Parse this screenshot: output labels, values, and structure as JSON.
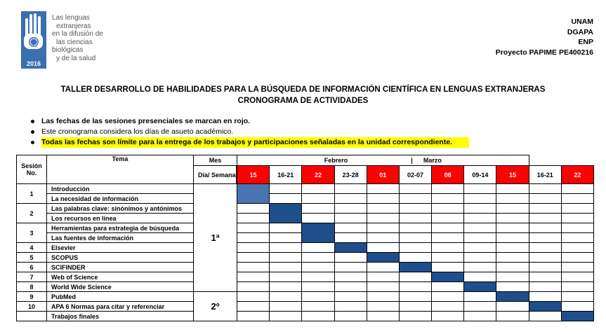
{
  "logo": {
    "year": "2016",
    "lines": [
      "Las lenguas",
      "extranjeras",
      "en la difusión de",
      "las ciencias",
      "biológicas",
      "y de la salud"
    ]
  },
  "institution": [
    "UNAM",
    "DGAPA",
    "ENP",
    "Proyecto PAPIME PE400216"
  ],
  "title": "TALLER DESARROLLO DE HABILIDADES PARA LA BÚSQUEDA DE INFORMACIÓN CIENTÍFICA EN LENGUAS EXTRANJERAS",
  "subtitle": "CRONOGRAMA DE ACTIVIDADES",
  "notes": [
    "Las fechas de las sesiones presenciales se marcan en rojo.",
    "Este cronograma considera los días de asueto académico.",
    "Todas las fechas son límite para la entrega de los trabajos y participaciones señaladas en la unidad correspondiente."
  ],
  "table": {
    "header": {
      "session": "Sesión No.",
      "topic": "Tema",
      "mes": "Mes",
      "dia": "Día/ Semana",
      "months": "Febrero                                    |      Marzo"
    },
    "weeks": [
      {
        "label": "15",
        "red": true
      },
      {
        "label": "16-21",
        "red": false
      },
      {
        "label": "22",
        "red": true
      },
      {
        "label": "23-28",
        "red": false
      },
      {
        "label": "01",
        "red": true
      },
      {
        "label": "02-07",
        "red": false
      },
      {
        "label": "08",
        "red": true
      },
      {
        "label": "09-14",
        "red": false
      },
      {
        "label": "15",
        "red": true
      },
      {
        "label": "16-21",
        "red": false
      },
      {
        "label": "22",
        "red": true
      }
    ],
    "sessions": [
      {
        "num": "1",
        "topics": [
          "Introducción",
          "La necesidad de información"
        ]
      },
      {
        "num": "2",
        "topics": [
          "Las palabras clave: sinónimos y antónimos",
          "Los recursos en línea"
        ]
      },
      {
        "num": "3",
        "topics": [
          "Herramientas para estrategia de búsqueda",
          "Las fuentes de información"
        ]
      },
      {
        "num": "4",
        "topics": [
          "Elsevier"
        ]
      },
      {
        "num": "5",
        "topics": [
          "SCOPUS"
        ]
      },
      {
        "num": "6",
        "topics": [
          "SCIFINDER"
        ]
      },
      {
        "num": "7",
        "topics": [
          "Web of Science"
        ]
      },
      {
        "num": "8",
        "topics": [
          "World Wide Science"
        ]
      },
      {
        "num": "9",
        "topics": [
          "PubMed"
        ]
      },
      {
        "num": "10",
        "topics": [
          "APA 6 Normas para citar y referenciar"
        ]
      },
      {
        "num": "",
        "topics": [
          "Trabajos finales"
        ]
      }
    ],
    "semanas": [
      {
        "label": "1ª",
        "first_row": 0,
        "row_count": 11
      },
      {
        "label": "2º",
        "first_row": 11,
        "row_count": 3
      }
    ],
    "colors": {
      "red": "#ff0000",
      "bar": "#1f4e8c",
      "bar_first": "#4a74b0",
      "highlight": "#ffff00"
    },
    "bars": [
      {
        "session": 0,
        "week": 0
      },
      {
        "session": 1,
        "week": 1
      },
      {
        "session": 2,
        "week": 2
      },
      {
        "session": 3,
        "week": 3
      },
      {
        "session": 4,
        "week": 4
      },
      {
        "session": 5,
        "week": 5
      },
      {
        "session": 6,
        "week": 6
      },
      {
        "session": 7,
        "week": 7
      },
      {
        "session": 8,
        "week": 8
      },
      {
        "session": 9,
        "week": 9
      },
      {
        "session": 10,
        "week": 10
      }
    ]
  }
}
